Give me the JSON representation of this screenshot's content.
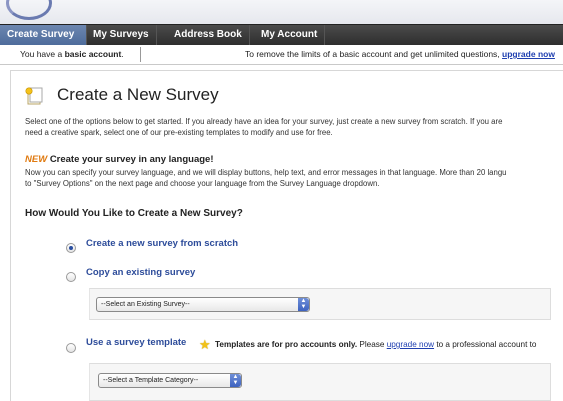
{
  "nav": {
    "items": [
      {
        "label": "Create Survey",
        "active": true
      },
      {
        "label": "My Surveys",
        "active": false
      },
      {
        "label": "Address Book",
        "active": false
      },
      {
        "label": "My Account",
        "active": false
      }
    ]
  },
  "infobar": {
    "prefix": "You have a ",
    "plan": "basic account",
    "suffix": ".",
    "upgrade_text": "To remove the limits of a basic account and get unlimited questions,",
    "upgrade_link": "upgrade now"
  },
  "page": {
    "title": "Create a New Survey",
    "intro_line1": "Select one of the options below to get started. If you already have an idea for your survey, just create a new survey from scratch. If you are",
    "intro_line2": "need a creative spark, select one of our pre-existing templates to modify and use for free.",
    "new_tag": "NEW",
    "language_heading": "Create your survey in any language!",
    "language_line1": "Now you can specify your survey language, and we will display buttons, help text, and error messages in that language. More than 20 langu",
    "language_line2": "to \"Survey Options\" on the next page and choose your language from the Survey Language dropdown.",
    "section_heading": "How Would You Like to Create a New Survey?"
  },
  "options": {
    "scratch": {
      "label": "Create a new survey from scratch",
      "selected": true
    },
    "copy": {
      "label": "Copy an existing survey",
      "selected": false,
      "select_value": "--Select an Existing Survey--"
    },
    "template": {
      "label": "Use a survey template",
      "selected": false,
      "note_bold": "Templates are for pro accounts only.",
      "note_pre_link": " Please ",
      "note_link": "upgrade now",
      "note_post_link": " to a professional account to",
      "select_value": "--Select a Template Category--"
    }
  },
  "colors": {
    "nav_active": "#5b78a8",
    "link": "#1f3fb0",
    "new_tag": "#e07a10",
    "option_label": "#2d4c9a"
  }
}
